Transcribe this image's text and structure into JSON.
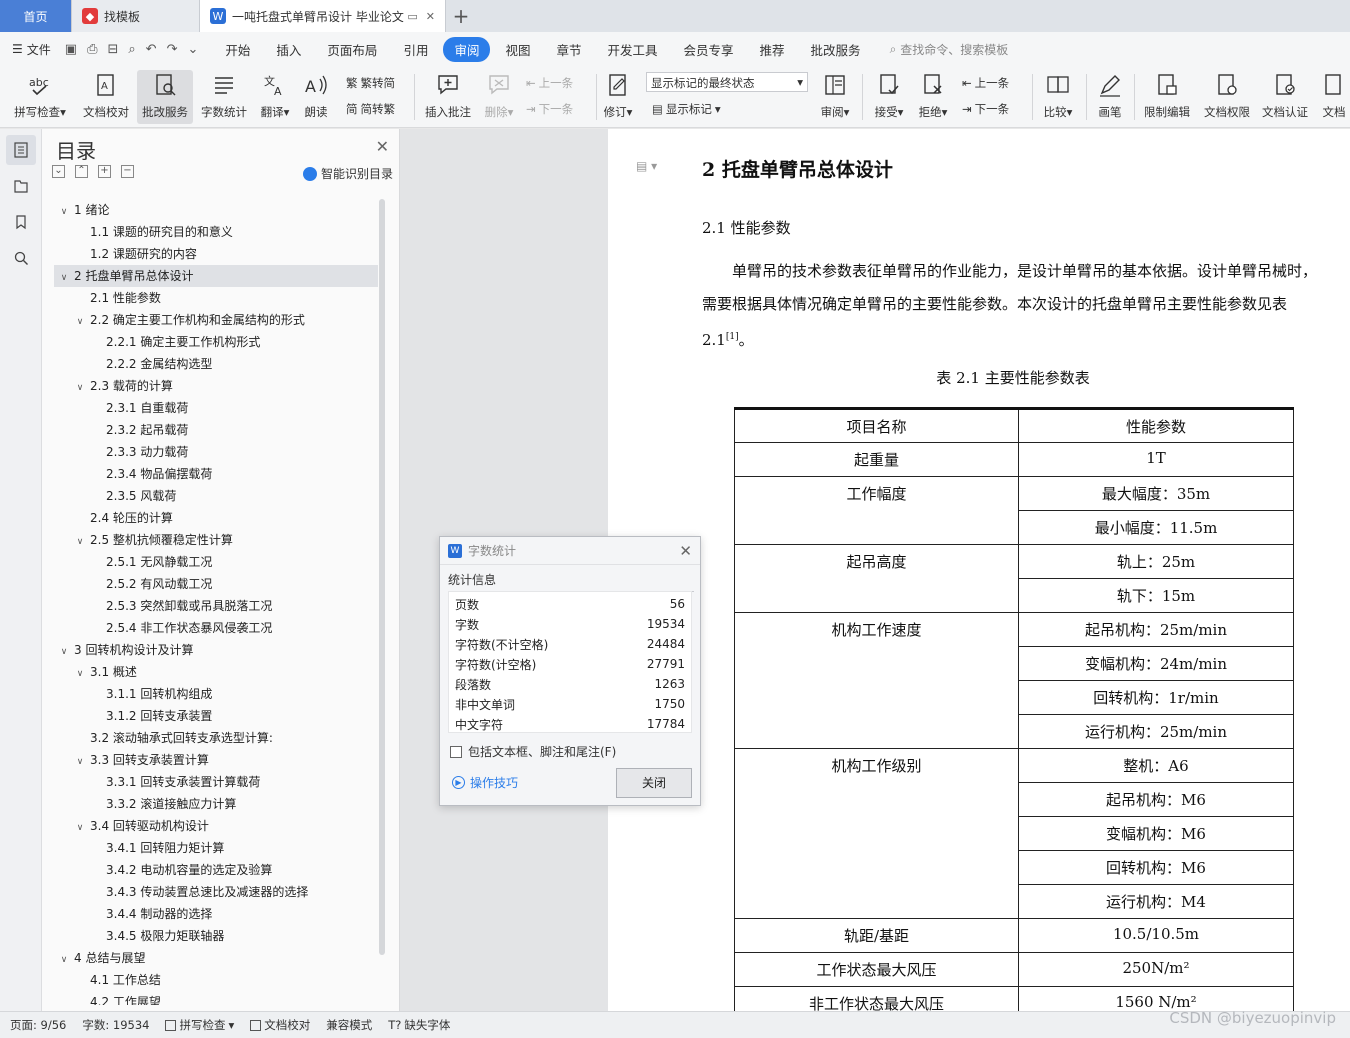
{
  "tabs": {
    "home": "首页",
    "templates": "找模板",
    "document": "一吨托盘式单臂吊设计 毕业论文"
  },
  "menu": {
    "file": "文件",
    "items": [
      "开始",
      "插入",
      "页面布局",
      "引用",
      "审阅",
      "视图",
      "章节",
      "开发工具",
      "会员专享",
      "推荐",
      "批改服务"
    ],
    "active": "审阅",
    "search": "查找命令、搜索模板"
  },
  "ribbon": {
    "spell": "拼写检查",
    "proof": "文档校对",
    "review_service": "批改服务",
    "word_count": "字数统计",
    "translate": "翻译",
    "read_aloud": "朗读",
    "to_traditional": "繁转简",
    "to_simplified": "简转繁",
    "insert_comment": "插入批注",
    "delete": "删除",
    "prev": "上一条",
    "next": "下一条",
    "track": "修订",
    "markup_state": "显示标记的最终状态",
    "show_markup": "显示标记",
    "review": "审阅",
    "accept": "接受",
    "reject": "拒绝",
    "prev2": "上一条",
    "next2": "下一条",
    "compare": "比较",
    "pen": "画笔",
    "restrict": "限制编辑",
    "permission": "文档权限",
    "certify": "文档认证",
    "more": "文档"
  },
  "toc": {
    "title": "目录",
    "smart": "智能识别目录",
    "items": [
      {
        "level": 1,
        "caret": "∨",
        "text": "1  绪论"
      },
      {
        "level": 2,
        "caret": "",
        "text": "1.1  课题的研究目的和意义"
      },
      {
        "level": 2,
        "caret": "",
        "text": "1.2  课题研究的内容"
      },
      {
        "level": 1,
        "caret": "∨",
        "text": "2  托盘单臂吊总体设计",
        "selected": true
      },
      {
        "level": 2,
        "caret": "",
        "text": "2.1  性能参数"
      },
      {
        "level": 2,
        "caret": "∨",
        "text": "2.2  确定主要工作机构和金属结构的形式"
      },
      {
        "level": 3,
        "caret": "",
        "text": "2.2.1  确定主要工作机构形式"
      },
      {
        "level": 3,
        "caret": "",
        "text": "2.2.2  金属结构选型"
      },
      {
        "level": 2,
        "caret": "∨",
        "text": "2.3  载荷的计算"
      },
      {
        "level": 3,
        "caret": "",
        "text": "2.3.1  自重载荷"
      },
      {
        "level": 3,
        "caret": "",
        "text": "2.3.2  起吊载荷"
      },
      {
        "level": 3,
        "caret": "",
        "text": "2.3.3  动力载荷"
      },
      {
        "level": 3,
        "caret": "",
        "text": "2.3.4  物品偏摆载荷"
      },
      {
        "level": 3,
        "caret": "",
        "text": "2.3.5  风载荷"
      },
      {
        "level": 2,
        "caret": "",
        "text": "2.4  轮压的计算"
      },
      {
        "level": 2,
        "caret": "∨",
        "text": "2.5  整机抗倾覆稳定性计算"
      },
      {
        "level": 3,
        "caret": "",
        "text": "2.5.1  无风静载工况"
      },
      {
        "level": 3,
        "caret": "",
        "text": "2.5.2  有风动载工况"
      },
      {
        "level": 3,
        "caret": "",
        "text": "2.5.3  突然卸载或吊具脱落工况"
      },
      {
        "level": 3,
        "caret": "",
        "text": "2.5.4  非工作状态暴风侵袭工况"
      },
      {
        "level": 1,
        "caret": "∨",
        "text": "3  回转机构设计及计算"
      },
      {
        "level": 2,
        "caret": "∨",
        "text": "3.1  概述"
      },
      {
        "level": 3,
        "caret": "",
        "text": "3.1.1  回转机构组成"
      },
      {
        "level": 3,
        "caret": "",
        "text": "3.1.2  回转支承装置"
      },
      {
        "level": 2,
        "caret": "",
        "text": "3.2  滚动轴承式回转支承选型计算:"
      },
      {
        "level": 2,
        "caret": "∨",
        "text": "3.3  回转支承装置计算"
      },
      {
        "level": 3,
        "caret": "",
        "text": "3.3.1  回转支承装置计算载荷"
      },
      {
        "level": 3,
        "caret": "",
        "text": "3.3.2  滚道接触应力计算"
      },
      {
        "level": 2,
        "caret": "∨",
        "text": "3.4  回转驱动机构设计"
      },
      {
        "level": 3,
        "caret": "",
        "text": "3.4.1  回转阻力矩计算"
      },
      {
        "level": 3,
        "caret": "",
        "text": "3.4.2  电动机容量的选定及验算"
      },
      {
        "level": 3,
        "caret": "",
        "text": "3.4.3  传动装置总速比及减速器的选择"
      },
      {
        "level": 3,
        "caret": "",
        "text": "3.4.4  制动器的选择"
      },
      {
        "level": 3,
        "caret": "",
        "text": "3.4.5  极限力矩联轴器"
      },
      {
        "level": 1,
        "caret": "∨",
        "text": "4  总结与展望"
      },
      {
        "level": 2,
        "caret": "",
        "text": "4.1  工作总结"
      },
      {
        "level": 2,
        "caret": "",
        "text": "4.2  工作展望"
      }
    ]
  },
  "doc": {
    "h1": "2  托盘单臂吊总体设计",
    "h2": "2.1  性能参数",
    "para": "单臂吊的技术参数表征单臂吊的作业能力，是设计单臂吊的基本依据。设计单臂吊械时，需要根据具体情况确定单臂吊的主要性能参数。本次设计的托盘单臂吊主要性能参数见表 2.1",
    "para_ref": "[1]",
    "para_end": "。",
    "caption": "表 2.1  主要性能参数表",
    "table": {
      "header": [
        "项目名称",
        "性能参数"
      ],
      "rows": [
        {
          "name": "起重量",
          "values": [
            "1T"
          ]
        },
        {
          "name": "工作幅度",
          "values": [
            "最大幅度：35m",
            "最小幅度：11.5m"
          ]
        },
        {
          "name": "起吊高度",
          "values": [
            "轨上：25m",
            "轨下：15m"
          ]
        },
        {
          "name": "机构工作速度",
          "values": [
            "起吊机构：25m/min",
            "变幅机构：24m/min",
            "回转机构：1r/min",
            "运行机构：25m/min"
          ]
        },
        {
          "name": "机构工作级别",
          "values": [
            "整机：A6",
            "起吊机构：M6",
            "变幅机构：M6",
            "回转机构：M6",
            "运行机构：M4"
          ]
        },
        {
          "name": "轨距/基距",
          "values": [
            "10.5/10.5m"
          ]
        },
        {
          "name": "工作状态最大风压",
          "values": [
            "250N/m²"
          ]
        },
        {
          "name": "非工作状态最大风压",
          "values": [
            "1560 N/m²"
          ]
        }
      ]
    }
  },
  "dialog": {
    "title": "字数统计",
    "section": "统计信息",
    "rows": [
      {
        "label": "页数",
        "value": "56"
      },
      {
        "label": "字数",
        "value": "19534"
      },
      {
        "label": "字符数(不计空格)",
        "value": "24484"
      },
      {
        "label": "字符数(计空格)",
        "value": "27791"
      },
      {
        "label": "段落数",
        "value": "1263"
      },
      {
        "label": "非中文单词",
        "value": "1750"
      },
      {
        "label": "中文字符",
        "value": "17784"
      }
    ],
    "checkbox": "包括文本框、脚注和尾注(F)",
    "tips": "操作技巧",
    "close": "关闭"
  },
  "status": {
    "page": "页面: 9/56",
    "words": "字数: 19534",
    "spell": "拼写检查",
    "proof": "文档校对",
    "compat": "兼容模式",
    "missing_font": "缺失字体"
  },
  "watermark": "CSDN @biyezuopinvip"
}
